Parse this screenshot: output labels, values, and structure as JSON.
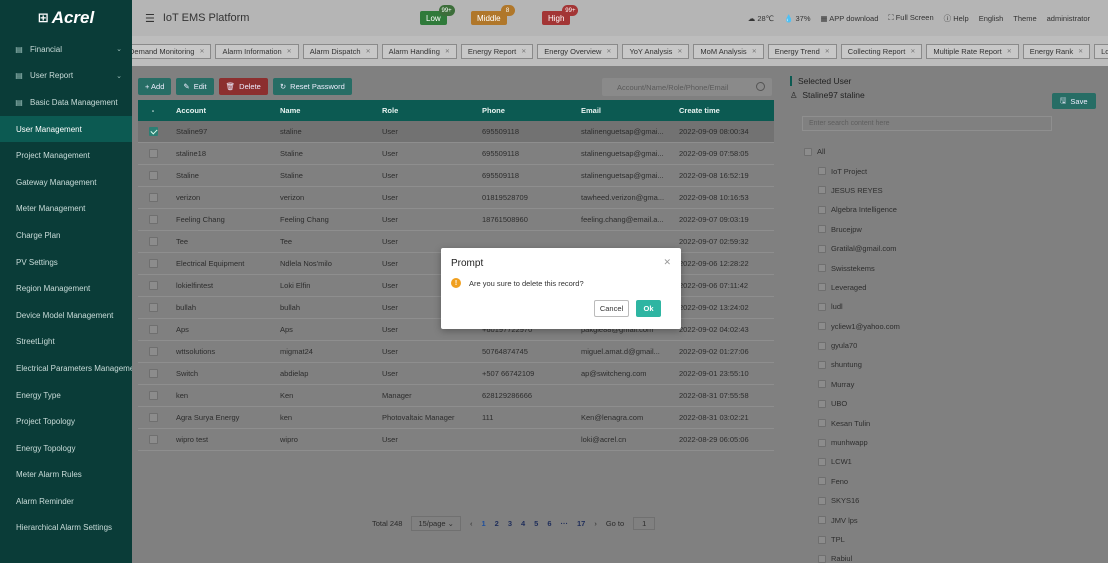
{
  "app": {
    "logo": "Acrel",
    "title": "IoT EMS Platform"
  },
  "colors": {
    "sidebar_bg": "#0a3c38",
    "primary": "#0c5a52",
    "accent": "#2eb5a2",
    "low": "#3aa14a",
    "middle": "#e69a1e",
    "high": "#d84040"
  },
  "header": {
    "alarms": [
      {
        "label": "Low",
        "count": "99+"
      },
      {
        "label": "Middle",
        "count": "8"
      },
      {
        "label": "High",
        "count": "99+"
      }
    ],
    "temperature": "28℃",
    "humidity": "37%",
    "app_download": "APP download",
    "full_screen": "Full Screen",
    "help": "Help",
    "language": "English",
    "theme": "Theme",
    "user": "administrator"
  },
  "sidebar": {
    "items": [
      {
        "label": "Financial",
        "icon": "financial-icon",
        "arrow": "⌄"
      },
      {
        "label": "User Report",
        "icon": "report-icon",
        "arrow": "⌄"
      },
      {
        "label": "Basic Data Management",
        "icon": "data-icon",
        "arrow": ""
      },
      {
        "label": "User Management",
        "sub": true,
        "active": true
      },
      {
        "label": "Project Management",
        "sub": true
      },
      {
        "label": "Gateway Management",
        "sub": true
      },
      {
        "label": "Meter Management",
        "sub": true
      },
      {
        "label": "Charge Plan",
        "sub": true
      },
      {
        "label": "PV Settings",
        "sub": true
      },
      {
        "label": "Region Management",
        "sub": true
      },
      {
        "label": "Device Model Management",
        "sub": true
      },
      {
        "label": "StreetLight",
        "sub": true
      },
      {
        "label": "Electrical Parameters Management",
        "sub": true
      },
      {
        "label": "Energy Type",
        "sub": true
      },
      {
        "label": "Project Topology",
        "sub": true
      },
      {
        "label": "Energy Topology",
        "sub": true
      },
      {
        "label": "Meter Alarm Rules",
        "sub": true
      },
      {
        "label": "Alarm Reminder",
        "sub": true
      },
      {
        "label": "Hierarchical Alarm Settings",
        "sub": true
      }
    ]
  },
  "tabs": [
    "Demand Monitoring",
    "Alarm Information",
    "Alarm Dispatch",
    "Alarm Handling",
    "Energy Report",
    "Energy Overview",
    "YoY Analysis",
    "MoM Analysis",
    "Energy Trend",
    "Collecting Report",
    "Multiple Rate Report",
    "Energy Rank",
    "Lo"
  ],
  "toolbar": {
    "add": "+ Add",
    "edit": "Edit",
    "delete": "Delete",
    "reset_password": "Reset Password"
  },
  "search": {
    "placeholder": "Account/Name/Role/Phone/Email"
  },
  "table": {
    "columns": [
      "-",
      "Account",
      "Name",
      "Role",
      "Phone",
      "Email",
      "Create time"
    ],
    "rows": [
      {
        "checked": true,
        "account": "Staline97",
        "name": "staline",
        "role": "User",
        "phone": "695509118",
        "email": "stalinenguetsap@gmai...",
        "time": "2022-09-09 08:00:34"
      },
      {
        "checked": false,
        "account": "staline18",
        "name": "Staline",
        "role": "User",
        "phone": "695509118",
        "email": "stalinenguetsap@gmai...",
        "time": "2022-09-09 07:58:05"
      },
      {
        "checked": false,
        "account": "Staline",
        "name": "Staline",
        "role": "User",
        "phone": "695509118",
        "email": "stalinenguetsap@gmai...",
        "time": "2022-09-08 16:52:19"
      },
      {
        "checked": false,
        "account": "verizon",
        "name": "verizon",
        "role": "User",
        "phone": "01819528709",
        "email": "tawheed.verizon@gma...",
        "time": "2022-09-08 10:16:53"
      },
      {
        "checked": false,
        "account": "Feeling Chang",
        "name": "Feeling Chang",
        "role": "User",
        "phone": "18761508960",
        "email": "feeling.chang@email.a...",
        "time": "2022-09-07 09:03:19"
      },
      {
        "checked": false,
        "account": "Tee",
        "name": "Tee",
        "role": "User",
        "phone": "",
        "email": "",
        "time": "2022-09-07 02:59:32"
      },
      {
        "checked": false,
        "account": "Electrical Equipment",
        "name": "Ndlela Nos'milo",
        "role": "User",
        "phone": "",
        "email": "",
        "time": "2022-09-06 12:28:22"
      },
      {
        "checked": false,
        "account": "lokielfintest",
        "name": "Loki Elfin",
        "role": "User",
        "phone": "",
        "email": "",
        "time": "2022-09-06 07:11:42"
      },
      {
        "checked": false,
        "account": "bullah",
        "name": "bullah",
        "role": "User",
        "phone": "",
        "email": "",
        "time": "2022-09-02 13:24:02"
      },
      {
        "checked": false,
        "account": "Aps",
        "name": "Aps",
        "role": "User",
        "phone": "+60197722970",
        "email": "pakgie88@gmail.com",
        "time": "2022-09-02 04:02:43"
      },
      {
        "checked": false,
        "account": "wttsolutions",
        "name": "migmat24",
        "role": "User",
        "phone": "50764874745",
        "email": "miguel.amat.d@gmail...",
        "time": "2022-09-02 01:27:06"
      },
      {
        "checked": false,
        "account": "Switch",
        "name": "abdielap",
        "role": "User",
        "phone": "+507 66742109",
        "email": "ap@switcheng.com",
        "time": "2022-09-01 23:55:10"
      },
      {
        "checked": false,
        "account": "ken",
        "name": "Ken",
        "role": "Manager",
        "phone": "628129286666",
        "email": "",
        "time": "2022-08-31 07:55:58"
      },
      {
        "checked": false,
        "account": "Agra Surya Energy",
        "name": "ken",
        "role": "Photovaltaic Manager",
        "phone": "111",
        "email": "Ken@lenagra.com",
        "time": "2022-08-31 03:02:21"
      },
      {
        "checked": false,
        "account": "wipro test",
        "name": "wipro",
        "role": "User",
        "phone": "",
        "email": "loki@acrel.cn",
        "time": "2022-08-29 06:05:06"
      }
    ]
  },
  "pagination": {
    "total": "Total 248",
    "page_size": "15/page",
    "pages": [
      "1",
      "2",
      "3",
      "4",
      "5",
      "6",
      "···",
      "17"
    ],
    "current": "1",
    "goto_label": "Go to",
    "goto_value": "1"
  },
  "right_panel": {
    "title": "Selected User",
    "selected_user": "Staline97 staline",
    "save": "Save",
    "search_placeholder": "Enter search content here",
    "all_label": "All",
    "projects": [
      "IoT Project",
      "JESUS REYES",
      "Algebra Intelligence",
      "Brucejpw",
      "Gratilal@gmail.com",
      "Swisstekems",
      "Leveraged",
      "ludl",
      "ycliew1@yahoo.com",
      "gyula70",
      "shuntung",
      "Murray",
      "UBO",
      "Kesan Tulin",
      "munhwapp",
      "LCW1",
      "Feno",
      "SKYS16",
      "JMV lps",
      "TPL",
      "Rabiul"
    ]
  },
  "modal": {
    "title": "Prompt",
    "message": "Are you sure to delete this record?",
    "cancel": "Cancel",
    "ok": "Ok"
  }
}
